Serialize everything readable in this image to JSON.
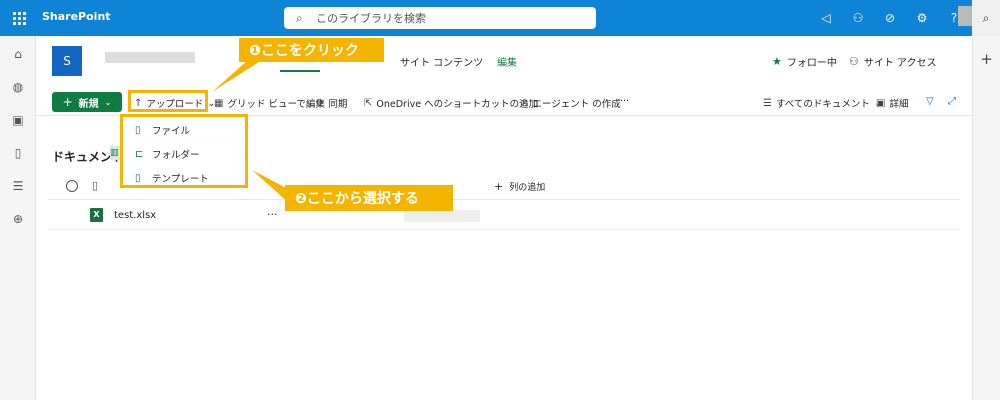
{
  "suitebar": {
    "app_name": "SharePoint",
    "search_placeholder": "このライブラリを検索",
    "icons": [
      "megaphone-icon",
      "sharepoint-icon",
      "copilot-icon",
      "settings-icon",
      "help-icon"
    ],
    "help_glyph": "?",
    "accent_color": "#0f83d6"
  },
  "site": {
    "logo_letter": "S",
    "nav_links": [
      "サイト コンテンツ",
      "編集"
    ],
    "follow_label": "フォロー中",
    "access_label": "サイト アクセス"
  },
  "commandbar": {
    "new_label": "新規",
    "upload_label": "アップロード",
    "grid_edit_label": "グリッド ビューで編集",
    "sync_label": "同期",
    "shortcut_label": "OneDrive へのショートカットの追加",
    "agent_label": "エージェント の作成",
    "more_glyph": "···",
    "view_label": "すべてのドキュメント",
    "details_label": "詳細",
    "brand_color": "#107c41"
  },
  "upload_menu": {
    "items": [
      "ファイル",
      "フォルダー",
      "テンプレート"
    ]
  },
  "annotations": {
    "step1": "❶ここをクリック",
    "step2": "❷ここから選択する",
    "color": "#f5b400"
  },
  "library": {
    "title": "ドキュメント",
    "add_column_label": "列の追加",
    "files": [
      {
        "name": "test.xlsx",
        "type_badge": "X"
      }
    ]
  },
  "right_rail": {
    "add_glyph": "+"
  }
}
